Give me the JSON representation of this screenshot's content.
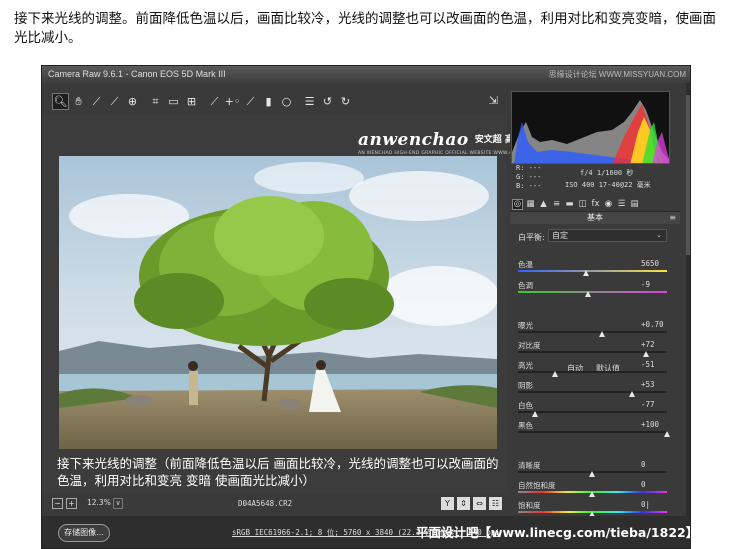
{
  "caption": "接下来光线的调整。前面降低色温以后，画面比较冷，光线的调整也可以改画面的色温，利用对比和变亮变暗，使画面光比减小。",
  "window": {
    "title": "Camera Raw 9.6.1 -  Canon EOS 5D Mark III",
    "watermark_top": "思缘设计论坛 WWW.MISSYUAN.COM"
  },
  "toolbar": {
    "tools": [
      {
        "icon": "zoom-icon",
        "glyph": "🔍︎",
        "active": true
      },
      {
        "icon": "hand-icon",
        "glyph": "✋︎"
      },
      {
        "icon": "white-balance-icon",
        "glyph": "⟋"
      },
      {
        "icon": "color-sampler-icon",
        "glyph": "⟋"
      },
      {
        "icon": "targeted-adjustment-icon",
        "glyph": "⊕"
      },
      {
        "icon": "crop-icon",
        "glyph": "⌗"
      },
      {
        "icon": "straighten-icon",
        "glyph": "▭"
      },
      {
        "icon": "transform-icon",
        "glyph": "⊞"
      },
      {
        "icon": "spot-removal-icon",
        "glyph": "⟋"
      },
      {
        "icon": "red-eye-icon",
        "glyph": "+◦"
      },
      {
        "icon": "adjustment-brush-icon",
        "glyph": "⟋"
      },
      {
        "icon": "graduated-filter-icon",
        "glyph": "▮"
      },
      {
        "icon": "radial-filter-icon",
        "glyph": "○"
      },
      {
        "icon": "preferences-icon",
        "glyph": "☰"
      },
      {
        "icon": "rotate-ccw-icon",
        "glyph": "↺"
      },
      {
        "icon": "rotate-cw-icon",
        "glyph": "↻"
      }
    ],
    "fullscreen_glyph": "⇲"
  },
  "brand": {
    "main": "anwenchao",
    "cn": "安文超 高端修图",
    "sub": "AN WENCHAO HIGH-END GRAPHIC OFFICIAL WEBSITE:WWW.ANWENCHAO.COM"
  },
  "overlay_text": "接下来光线的调整（前面降低色温以后 画面比较冷，光线的调整也可以改画面的色温，利用对比和变亮  变暗  使画面光比减小）",
  "statusbar": {
    "zoom_out": "−",
    "zoom_in": "+",
    "zoom": "12.3%",
    "zoom_dropdown": "∨",
    "filename": "D04A5648.CR2",
    "view_buttons": [
      "Y",
      "⇕",
      "⇔",
      "☷"
    ]
  },
  "bottombar": {
    "save_label": "存储图像...",
    "workflow": "sRGB IEC61966-2.1; 8 位; 5760 x 3840 (22.1 百万像素); 240 ppi",
    "watermark": "平面设计吧【www.linecg.com/tieba/1822】"
  },
  "readout": {
    "r": "R:  ---",
    "g": "G:  ---",
    "b": "B:  ---",
    "aperture_shutter": "f/4   1/1600 秒",
    "iso_lens": "ISO 400   17-40@22 毫米"
  },
  "panel_tabs": [
    "◎",
    "▦",
    "▲",
    "≡",
    "▬",
    "◫",
    "fx",
    "◉",
    "☰",
    "▤"
  ],
  "basic": {
    "title": "基本",
    "menu_glyph": "≡",
    "wb_label": "白平衡:",
    "wb_value": "自定",
    "auto": "自动",
    "default": "默认值",
    "sliders": [
      {
        "id": "temp",
        "label": "色温",
        "value": "5650",
        "pos": 0.46
      },
      {
        "id": "tint",
        "label": "色调",
        "value": "-9",
        "pos": 0.47
      },
      {
        "id": "exposure",
        "label": "曝光",
        "value": "+0.70",
        "pos": 0.57
      },
      {
        "id": "contrast",
        "label": "对比度",
        "value": "+72",
        "pos": 0.86
      },
      {
        "id": "highlights",
        "label": "高光",
        "value": "-51",
        "pos": 0.25
      },
      {
        "id": "shadows",
        "label": "阴影",
        "value": "+53",
        "pos": 0.77
      },
      {
        "id": "whites",
        "label": "白色",
        "value": "-77",
        "pos": 0.12
      },
      {
        "id": "blacks",
        "label": "黑色",
        "value": "+100",
        "pos": 1.0
      },
      {
        "id": "clarity",
        "label": "清晰度",
        "value": "0",
        "pos": 0.5
      },
      {
        "id": "vibrance",
        "label": "自然饱和度",
        "value": "0",
        "pos": 0.5
      },
      {
        "id": "saturation",
        "label": "饱和度",
        "value": "0|",
        "pos": 0.5
      }
    ]
  },
  "colors": {
    "window_bg": "#3a3a3a",
    "temp_gradient": [
      "#3060ff",
      "#ffe040"
    ],
    "tint_gradient": [
      "#30d030",
      "#e040e0"
    ]
  }
}
